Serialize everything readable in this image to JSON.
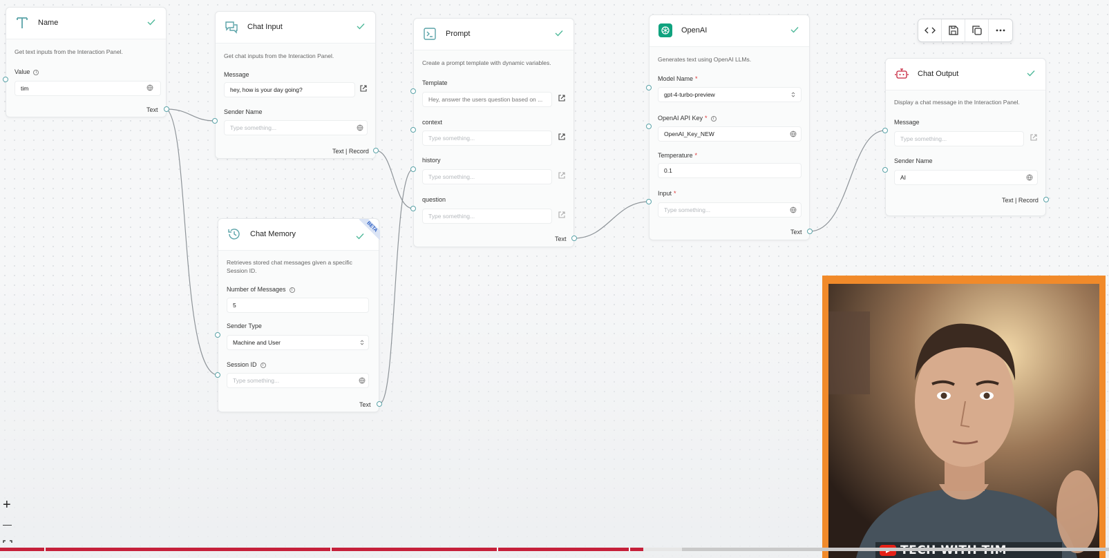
{
  "nodes": {
    "name": {
      "title": "Name",
      "description": "Get text inputs from the Interaction Panel.",
      "value_label": "Value",
      "value": "tim",
      "output_label": "Text"
    },
    "chat_input": {
      "title": "Chat Input",
      "description": "Get chat inputs from the Interaction Panel.",
      "message_label": "Message",
      "message_value": "hey, how is your day going?",
      "sender_name_label": "Sender Name",
      "sender_name_placeholder": "Type something...",
      "output_label": "Text | Record"
    },
    "chat_memory": {
      "title": "Chat Memory",
      "badge": "BETA",
      "description_line1": "Retrieves stored chat messages given a specific",
      "description_line2": "Session ID.",
      "num_messages_label": "Number of Messages",
      "num_messages_value": "5",
      "sender_type_label": "Sender Type",
      "sender_type_value": "Machine and User",
      "session_id_label": "Session ID",
      "session_id_placeholder": "Type something...",
      "output_label": "Text"
    },
    "prompt": {
      "title": "Prompt",
      "description": "Create a prompt template with dynamic variables.",
      "template_label": "Template",
      "template_value": "Hey, answer the users question based on ...",
      "context_label": "context",
      "context_placeholder": "Type something...",
      "history_label": "history",
      "history_placeholder": "Type something...",
      "question_label": "question",
      "question_placeholder": "Type something...",
      "output_label": "Text"
    },
    "openai": {
      "title": "OpenAI",
      "description": "Generates text using OpenAI LLMs.",
      "model_label": "Model Name",
      "model_value": "gpt-4-turbo-preview",
      "api_key_label": "OpenAI API Key",
      "api_key_value": "OpenAI_Key_NEW",
      "temperature_label": "Temperature",
      "temperature_value": "0.1",
      "input_label": "Input",
      "input_placeholder": "Type something...",
      "required_mark": "*",
      "output_label": "Text"
    },
    "chat_output": {
      "title": "Chat Output",
      "description": "Display a chat message in the Interaction Panel.",
      "message_label": "Message",
      "message_placeholder": "Type something...",
      "sender_name_label": "Sender Name",
      "sender_name_value": "AI",
      "output_label": "Text | Record"
    }
  },
  "toolbar": {
    "icons": [
      "code-icon",
      "save-icon",
      "duplicate-icon",
      "more-icon"
    ]
  },
  "zoom": {
    "in_label": "+",
    "out_label": "—"
  },
  "video": {
    "channel": "TECH WITH TIM",
    "progress_fraction": 0.58,
    "buffered_fraction": 0.615
  },
  "colors": {
    "accent": "#5aa3a8",
    "check": "#4fb99a",
    "youtube_red": "#c5203a",
    "overlay_orange": "#f18a2a",
    "openai_green": "#10a37f"
  }
}
